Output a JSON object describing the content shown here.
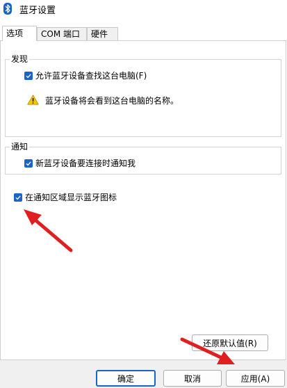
{
  "window": {
    "title": "蓝牙设置",
    "icon": "bluetooth-icon"
  },
  "tabs": [
    {
      "label": "选项",
      "active": true
    },
    {
      "label": "COM 端口",
      "active": false
    },
    {
      "label": "硬件",
      "active": false
    }
  ],
  "discovery": {
    "group_title": "发现",
    "allow_label": "允许蓝牙设备查找这台电脑(F)",
    "allow_checked": true,
    "warning_text": "蓝牙设备将会看到这台电脑的名称。",
    "warning_icon": "warning-icon"
  },
  "notification": {
    "group_title": "通知",
    "notify_label": "新蓝牙设备要连接时通知我",
    "notify_checked": true
  },
  "tray": {
    "label": "在通知区域显示蓝牙图标",
    "checked": true
  },
  "buttons": {
    "restore": "还原默认值(R)",
    "ok": "确定",
    "cancel": "取消",
    "apply": "应用(A)"
  },
  "colors": {
    "accent": "#1a63c9",
    "arrow": "#e02020"
  }
}
